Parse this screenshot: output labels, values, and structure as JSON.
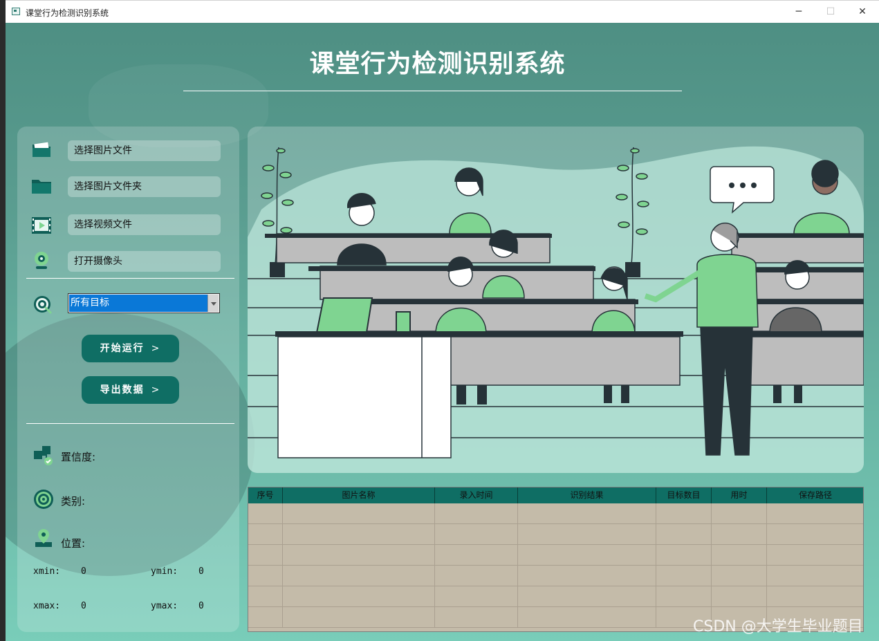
{
  "window": {
    "title": "课堂行为检测识别系统"
  },
  "app_title": "课堂行为检测识别系统",
  "sidebar": {
    "items": [
      {
        "label": "选择图片文件",
        "icon": "image-folder-icon"
      },
      {
        "label": "选择图片文件夹",
        "icon": "folder-icon"
      },
      {
        "label": "选择视频文件",
        "icon": "video-file-icon"
      },
      {
        "label": "打开摄像头",
        "icon": "webcam-icon"
      }
    ],
    "target_select": {
      "value": "所有目标",
      "icon": "target-icon"
    },
    "start_button": "开始运行",
    "export_button": "导出数据",
    "button_chevron": ">"
  },
  "info": {
    "confidence_label": "置信度:",
    "class_label": "类别:",
    "position_label": "位置:",
    "xmin_label": "xmin:",
    "xmin": "0",
    "ymin_label": "ymin:",
    "ymin": "0",
    "xmax_label": "xmax:",
    "xmax": "0",
    "ymax_label": "ymax:",
    "ymax": "0"
  },
  "table": {
    "columns": [
      "序号",
      "图片名称",
      "录入时间",
      "识别结果",
      "目标数目",
      "用时",
      "保存路径"
    ],
    "empty_rows": 6
  },
  "watermark": "CSDN @大学生毕业题目",
  "colors": {
    "accent": "#0f6e64",
    "selection": "#0a78d7",
    "table_bg": "#c4bba9",
    "figure_green": "#7fd491",
    "figure_dark": "#263238"
  }
}
